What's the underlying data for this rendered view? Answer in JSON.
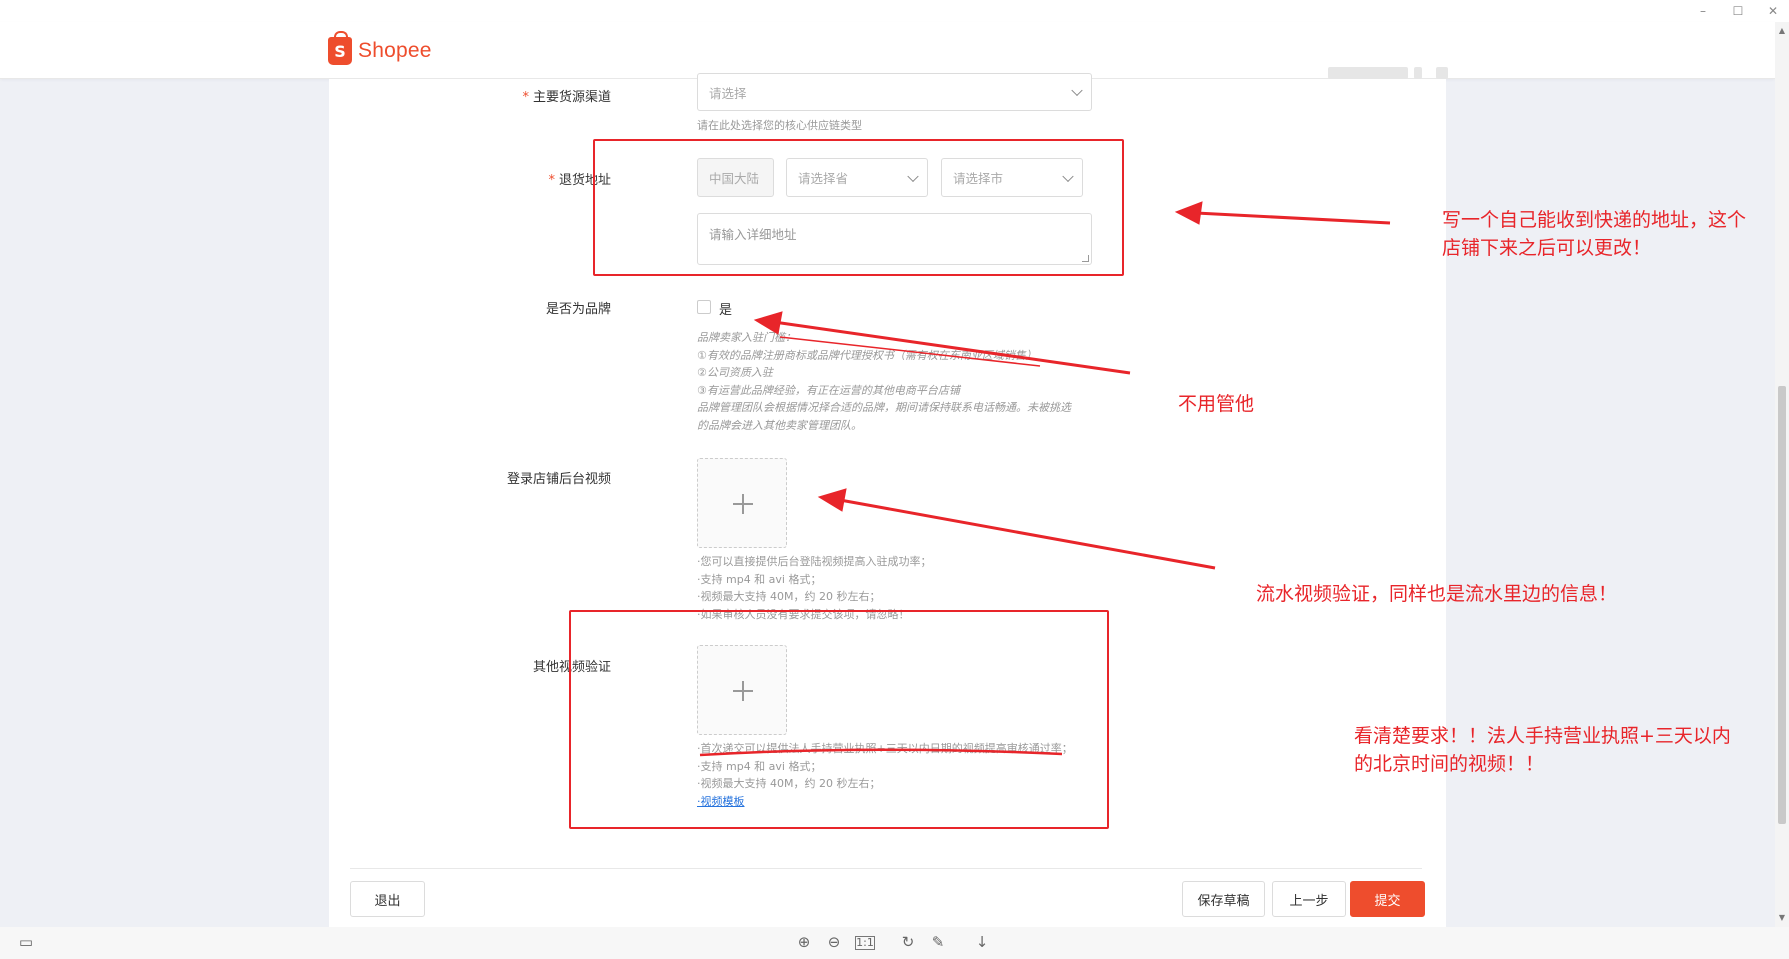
{
  "window": {
    "minimize": "–",
    "maximize": "☐",
    "close": "✕"
  },
  "header": {
    "logo_text": "Shopee",
    "logo_glyph": "S"
  },
  "form": {
    "supply_channel": {
      "label": "主要货源渠道",
      "placeholder": "请选择",
      "hint": "请在此处选择您的核心供应链类型"
    },
    "return_address": {
      "label": "退货地址",
      "country": "中国大陆",
      "province_placeholder": "请选择省",
      "city_placeholder": "请选择市",
      "detail_placeholder": "请输入详细地址"
    },
    "is_brand": {
      "label": "是否为品牌",
      "option": "是",
      "hints": [
        "品牌卖家入驻门槛：",
        "①有效的品牌注册商标或品牌代理授权书（需有权在东南亚区域销售）",
        "②公司资质入驻",
        "③有运营此品牌经验，有正在运营的其他电商平台店铺",
        "品牌管理团队会根据情况择合适的品牌，期间请保持联系电话畅通。未被挑选",
        "的品牌会进入其他卖家管理团队。"
      ]
    },
    "backend_video": {
      "label": "登录店铺后台视频",
      "hints": [
        "·您可以直接提供后台登陆视频提高入驻成功率；",
        "·支持 mp4 和 avi 格式；",
        "·视频最大支持 40M，约 20 秒左右；",
        "·如果审核人员没有要求提交该项，请忽略！"
      ]
    },
    "other_video": {
      "label": "其他视频验证",
      "hints": [
        "·首次递交可以提供法人手持营业执照+三天以内日期的视频提高审核通过率；",
        "·支持 mp4 和 avi 格式；",
        "·视频最大支持 40M，约 20 秒左右；"
      ],
      "template_link": "·视频模板"
    }
  },
  "footer": {
    "exit": "退出",
    "save_draft": "保存草稿",
    "prev": "上一步",
    "submit": "提交"
  },
  "annotations": {
    "address_note_1": "写一个自己能收到快递的地址，这个",
    "address_note_2": "店铺下来之后可以更改！",
    "brand_note": "不用管他",
    "video_note": "流水视频验证，同样也是流水里边的信息！",
    "other_video_note_1": "看清楚要求！！法人手持营业执照+三天以内",
    "other_video_note_2": "的北京时间的视频！！",
    "color": "#e8252a"
  },
  "toolbar": {
    "zoom_in": "⊕",
    "zoom_out": "⊖",
    "actual_size": "1:1",
    "rotate": "↻",
    "edit": "✎",
    "download": "↓",
    "screen": "▭"
  },
  "colors": {
    "brand": "#ee4d2d",
    "link": "#2673dd"
  }
}
